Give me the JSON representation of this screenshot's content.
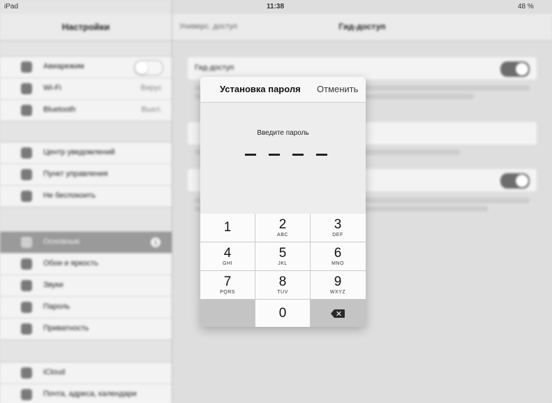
{
  "status_bar": {
    "left": "iPad",
    "time": "11:38",
    "right": "48 %"
  },
  "sidebar": {
    "title": "Настройки",
    "group1": [
      {
        "label": "Авиарежим",
        "value": "",
        "toggle": "off"
      },
      {
        "label": "Wi-Fi",
        "value": "Вируc"
      },
      {
        "label": "Bluetooth",
        "value": "Выкл."
      }
    ],
    "group2": [
      {
        "label": "Центр уведомлений"
      },
      {
        "label": "Пункт управления"
      },
      {
        "label": "Не беспокоить"
      }
    ],
    "group3": [
      {
        "label": "Основные",
        "badge": "1"
      },
      {
        "label": "Обои и яркость"
      },
      {
        "label": "Звуки"
      },
      {
        "label": "Пароль"
      },
      {
        "label": "Приватность"
      }
    ],
    "group4": [
      {
        "label": "iCloud"
      },
      {
        "label": "Почта, адреса, календари"
      }
    ]
  },
  "detail": {
    "back": "Универс. доступ",
    "title": "Гид-доступ",
    "cell1_label": "Гид-доступ"
  },
  "dialog": {
    "title": "Установка пароля",
    "cancel": "Отменить",
    "prompt": "Введите пароль",
    "keys": [
      {
        "digit": "1",
        "letters": ""
      },
      {
        "digit": "2",
        "letters": "ABC"
      },
      {
        "digit": "3",
        "letters": "DEF"
      },
      {
        "digit": "4",
        "letters": "GHI"
      },
      {
        "digit": "5",
        "letters": "JKL"
      },
      {
        "digit": "6",
        "letters": "MNO"
      },
      {
        "digit": "7",
        "letters": "PQRS"
      },
      {
        "digit": "8",
        "letters": "TUV"
      },
      {
        "digit": "9",
        "letters": "WXYZ"
      },
      {
        "digit": "0",
        "letters": ""
      }
    ],
    "delete_icon": "backspace-icon"
  },
  "colors": {
    "accent": "#6d6d6d",
    "dialog_bg": "#f7f7f7",
    "keypad_gap": "#c9c9c9"
  }
}
